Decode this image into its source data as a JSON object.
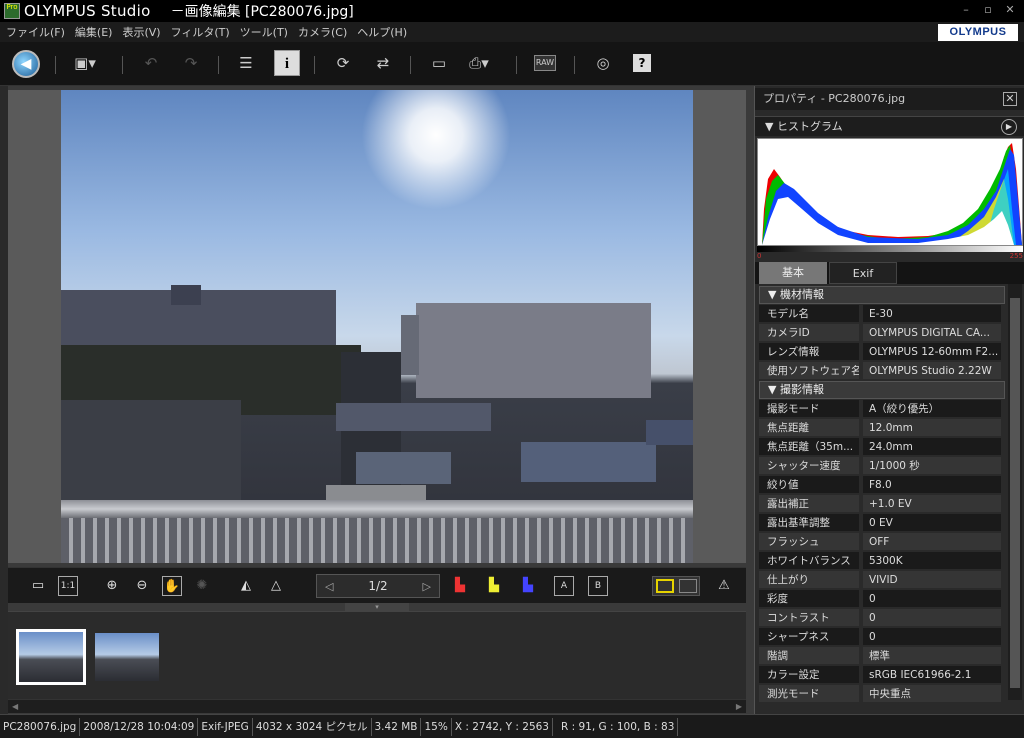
{
  "title": {
    "app": "OLYMPUS Studio",
    "document": "－画像編集 [PC280076.jpg]",
    "app_icon_text": "Pro"
  },
  "window_controls": {
    "minimize": "–",
    "restore": "▫",
    "close": "✕"
  },
  "menu": [
    "ファイル(F)",
    "編集(E)",
    "表示(V)",
    "フィルタ(T)",
    "ツール(T)",
    "カメラ(C)",
    "ヘルプ(H)"
  ],
  "logo": "OLYMPUS",
  "toolbar": {
    "raw_label": "RAW",
    "info_label": "i",
    "help_label": "?"
  },
  "image_controls": {
    "one_to_one": "1:1",
    "page": "1/2",
    "a_label": "A",
    "b_label": "B"
  },
  "filmstrip": {
    "count": 2,
    "selected": 0
  },
  "panel": {
    "title": "プロパティ - PC280076.jpg",
    "histogram_title": "ヒストグラム",
    "histogram_min": "0",
    "histogram_max": "255",
    "tabs": [
      "基本",
      "Exif"
    ],
    "active_tab": "基本",
    "groups": {
      "equipment": "機材情報",
      "shooting": "撮影情報"
    },
    "equipment_rows": [
      {
        "key": "モデル名",
        "value": "E-30"
      },
      {
        "key": "カメラID",
        "value": "OLYMPUS DIGITAL CA..."
      },
      {
        "key": "レンズ情報",
        "value": "OLYMPUS 12-60mm F2..."
      },
      {
        "key": "使用ソフトウェア名",
        "value": "OLYMPUS Studio 2.22W"
      }
    ],
    "shooting_rows": [
      {
        "key": "撮影モード",
        "value": "A（絞り優先）"
      },
      {
        "key": "焦点距離",
        "value": "12.0mm"
      },
      {
        "key": "焦点距離（35m...",
        "value": "24.0mm"
      },
      {
        "key": "シャッター速度",
        "value": "1/1000 秒"
      },
      {
        "key": "絞り値",
        "value": "F8.0"
      },
      {
        "key": "露出補正",
        "value": "+1.0 EV"
      },
      {
        "key": "露出基準調整",
        "value": "0 EV"
      },
      {
        "key": "フラッシュ",
        "value": "OFF"
      },
      {
        "key": "ホワイトバランス",
        "value": "5300K"
      },
      {
        "key": "仕上がり",
        "value": "VIVID"
      },
      {
        "key": "彩度",
        "value": "0"
      },
      {
        "key": "コントラスト",
        "value": "0"
      },
      {
        "key": "シャープネス",
        "value": "0"
      },
      {
        "key": "階調",
        "value": "標準"
      },
      {
        "key": "カラー設定",
        "value": "sRGB IEC61966-2.1"
      },
      {
        "key": "測光モード",
        "value": "中央重点"
      }
    ]
  },
  "status": {
    "filename": "PC280076.jpg",
    "datetime": "2008/12/28 10:04:09",
    "format": "Exif-JPEG",
    "dimensions": "4032 x 3024 ピクセル",
    "filesize": "3.42 MB",
    "zoom": "15%",
    "coords": "X : 2742, Y : 2563",
    "rgb": "R : 91, G : 100, B : 83"
  },
  "colors": {
    "accent_yellow": "#e6d300",
    "logo_blue": "#123a8c",
    "background": "#3a3a3a"
  }
}
